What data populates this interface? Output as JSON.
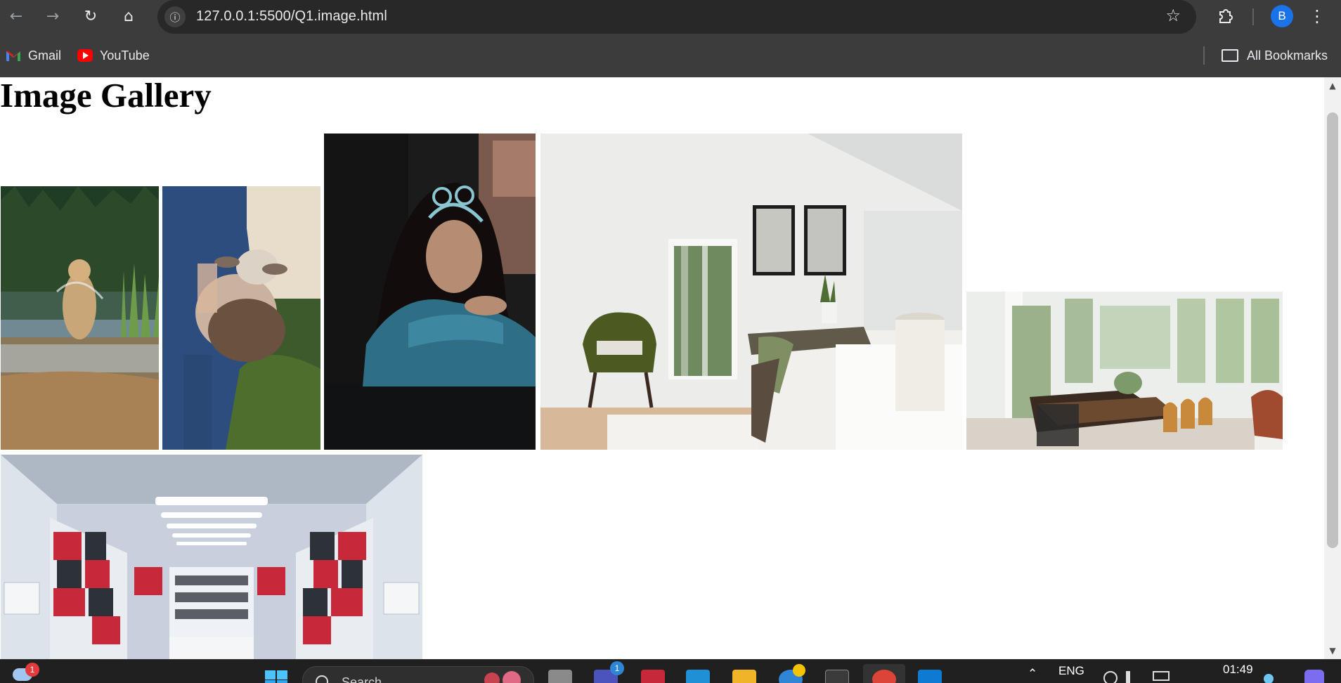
{
  "browser": {
    "url": "127.0.0.1:5500/Q1.image.html",
    "profile_initial": "B",
    "nav": {
      "back_icon": "←",
      "forward_icon": "→",
      "reload_icon": "↻",
      "home_icon": "⌂",
      "info_icon": "ⓘ",
      "star_icon": "☆",
      "menu_icon": "⋮"
    }
  },
  "bookmarks": {
    "items": [
      {
        "label": "Gmail",
        "icon": "gmail-icon"
      },
      {
        "label": "YouTube",
        "icon": "youtube-icon"
      }
    ],
    "all_bookmarks": "All Bookmarks"
  },
  "page": {
    "title": "Image Gallery",
    "images": [
      {
        "name": "dog-in-lake-image",
        "colors": [
          "#1f3d24",
          "#5d7a84",
          "#b59870",
          "#2d4f3a"
        ]
      },
      {
        "name": "goat-in-lap-image",
        "colors": [
          "#2d4a7a",
          "#c9b9a8",
          "#3b5d2a",
          "#8c6b4d"
        ]
      },
      {
        "name": "woman-denim-jacket-image",
        "colors": [
          "#1a1a1a",
          "#2f6f85",
          "#3a2b26",
          "#222"
        ]
      },
      {
        "name": "bedroom-interior-image",
        "colors": [
          "#f2f2f2",
          "#e6e3df",
          "#5b5a2c",
          "#d8c4a3"
        ]
      },
      {
        "name": "dining-room-interior-image",
        "colors": [
          "#eef0ee",
          "#c7d6c2",
          "#6b4a30",
          "#f5f5f3"
        ]
      },
      {
        "name": "library-shelves-image",
        "colors": [
          "#c9d1dc",
          "#e8edf2",
          "#c7283a",
          "#2b2f35"
        ]
      }
    ]
  },
  "scrollbar": {
    "up_icon": "▲",
    "down_icon": "▼"
  },
  "taskbar": {
    "search_label": "Search",
    "language": "ENG",
    "time": "01:49",
    "weather_badge": "1",
    "teams_badge": "1"
  }
}
